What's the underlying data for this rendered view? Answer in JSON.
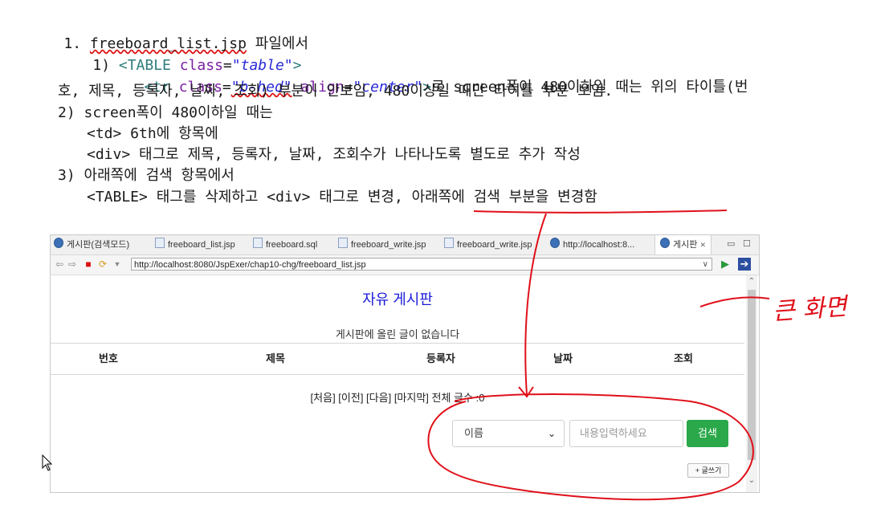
{
  "doc": {
    "line1_num": "1. ",
    "line1_file": "freeboard_list.jsp",
    "line1_rest": " 파일에서",
    "l2_prefix": "1) ",
    "l2_tag_open": "<TABLE ",
    "l2_attr": "class",
    "l2_eq": "=",
    "l2_val": "\"table\"",
    "l2_close": ">",
    "l3_tag_open": "<tr ",
    "l3_attr1": "class",
    "l3_eq1": "=",
    "l3_val1": "\"b-hed\"",
    "l3_attr2": " align",
    "l3_eq2": "=",
    "l3_val2": "\"center\"",
    "l3_close": ">",
    "l3_rest": "로 screen폭이 480이하일 때는 위의 타이틀(번",
    "l4": "호, 제목, 등록자, 날짜, 조회) 부분이 안보임, 480이상일 때만 타이틀 부분 보임.",
    "l5": "2) screen폭이 480이하일 때는",
    "l6": "<td> 6th에 항목에",
    "l7": "<div> 태그로 제목, 등록자, 날짜, 조회수가 나타나도록 별도로 추가 작성",
    "l8": "3) 아래쪽에 검색 항목에서",
    "l9": "<TABLE> 태그를 삭제하고 <div> 태그로 변경, 아래쪽에 검색 부분을 변경함"
  },
  "browser": {
    "tabs": [
      {
        "label": "게시판(검색모드)",
        "icon": "globe-icon"
      },
      {
        "label": "freeboard_list.jsp",
        "icon": "file-icon"
      },
      {
        "label": "freeboard.sql",
        "icon": "sql-file-icon"
      },
      {
        "label": "freeboard_write.jsp",
        "icon": "file-icon"
      },
      {
        "label": "freeboard_write.jsp",
        "icon": "file-icon"
      },
      {
        "label": "http://localhost:8...",
        "icon": "globe-icon"
      },
      {
        "label": "게시판",
        "icon": "globe-icon",
        "close": "✕"
      }
    ],
    "window_min": "▭",
    "window_max": "☐",
    "url": "http://localhost:8080/JspExer/chap10-chg/freeboard_list.jsp",
    "page": {
      "title": "자유 게시판",
      "empty_message": "게시판에 올린 글이 없습니다",
      "headers": [
        "번호",
        "제목",
        "등록자",
        "날짜",
        "조회"
      ],
      "pager": "[처음] [이전] [다음] [마지막] 전체 글수 :0",
      "search_select": "이름",
      "search_placeholder": "내용입력하세요",
      "search_button": "검색",
      "write_button": "+ 글쓰기"
    }
  },
  "annotation": {
    "handwriting": "큰 화면",
    "color": "#e0101a"
  }
}
